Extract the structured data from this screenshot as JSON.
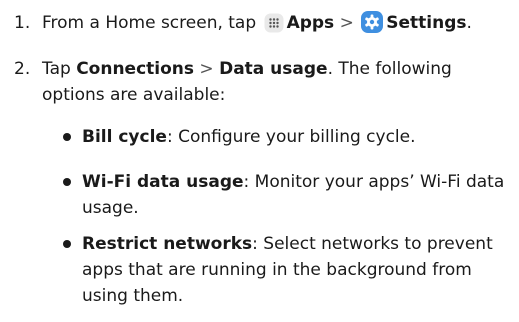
{
  "steps": [
    {
      "number": "1.",
      "pre": "From a Home screen, tap",
      "apps_label": "Apps",
      "separator": ">",
      "settings_label": "Settings",
      "end": "."
    },
    {
      "number": "2.",
      "pre": "Tap",
      "connections_label": "Connections",
      "separator": ">",
      "data_usage_label": "Data usage",
      "post_line1": ". The following",
      "post_line2": "options are available:"
    }
  ],
  "options": [
    {
      "title": "Bill cycle",
      "lines": [
        ": Configure your billing cycle."
      ]
    },
    {
      "title": "Wi-Fi data usage",
      "lines": [
        ": Monitor your apps’ Wi-Fi data",
        "usage."
      ]
    },
    {
      "title": "Restrict networks",
      "lines": [
        ": Select networks to prevent",
        "apps that are running in the background from",
        "using them."
      ]
    }
  ],
  "icons": {
    "apps": "apps-grid-icon",
    "settings": "settings-gear-icon"
  },
  "colors": {
    "text": "#1a1a1a",
    "settings_icon": "#3f8fe0",
    "apps_icon_bg": "#e9e9e9"
  }
}
